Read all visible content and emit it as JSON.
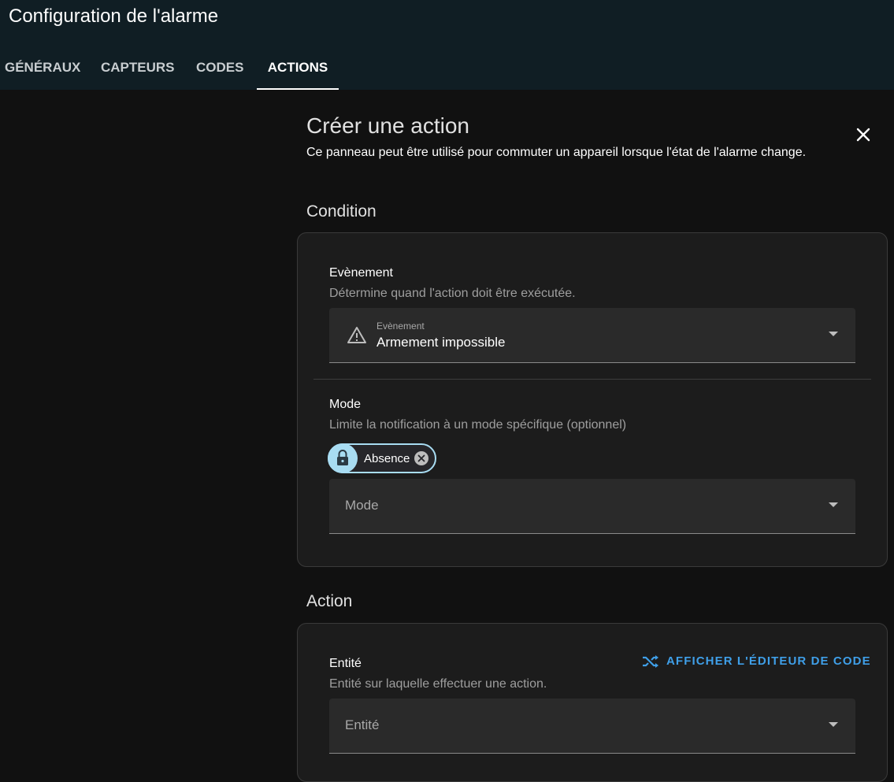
{
  "header": {
    "title": "Configuration de l'alarme",
    "tabs": [
      {
        "label": "GÉNÉRAUX",
        "active": false
      },
      {
        "label": "CAPTEURS",
        "active": false
      },
      {
        "label": "CODES",
        "active": false
      },
      {
        "label": "ACTIONS",
        "active": true
      }
    ]
  },
  "panel": {
    "title": "Créer une action",
    "description": "Ce panneau peut être utilisé pour commuter un appareil lorsque l'état de l'alarme change.",
    "close_icon": "close-icon"
  },
  "condition": {
    "section_title": "Condition",
    "event": {
      "label": "Evènement",
      "help": "Détermine quand l'action doit être exécutée.",
      "select_label": "Evènement",
      "select_value": "Armement impossible",
      "icon": "alert-triangle-icon"
    },
    "mode": {
      "label": "Mode",
      "help": "Limite la notification à un mode spécifique (optionnel)",
      "chip_label": "Absence",
      "chip_icon": "lock-icon",
      "select_placeholder": "Mode"
    }
  },
  "action": {
    "section_title": "Action",
    "code_editor_label": "AFFICHER L'ÉDITEUR DE CODE",
    "code_editor_icon": "shuffle-icon",
    "entity": {
      "label": "Entité",
      "help": "Entité sur laquelle effectuer une action.",
      "select_placeholder": "Entité"
    }
  },
  "colors": {
    "header_bg": "#101e24",
    "page_bg": "#111111",
    "card_bg": "#1c1c1c",
    "accent_blue": "#3f9fe8",
    "chip_accent": "#a8dcf2"
  }
}
